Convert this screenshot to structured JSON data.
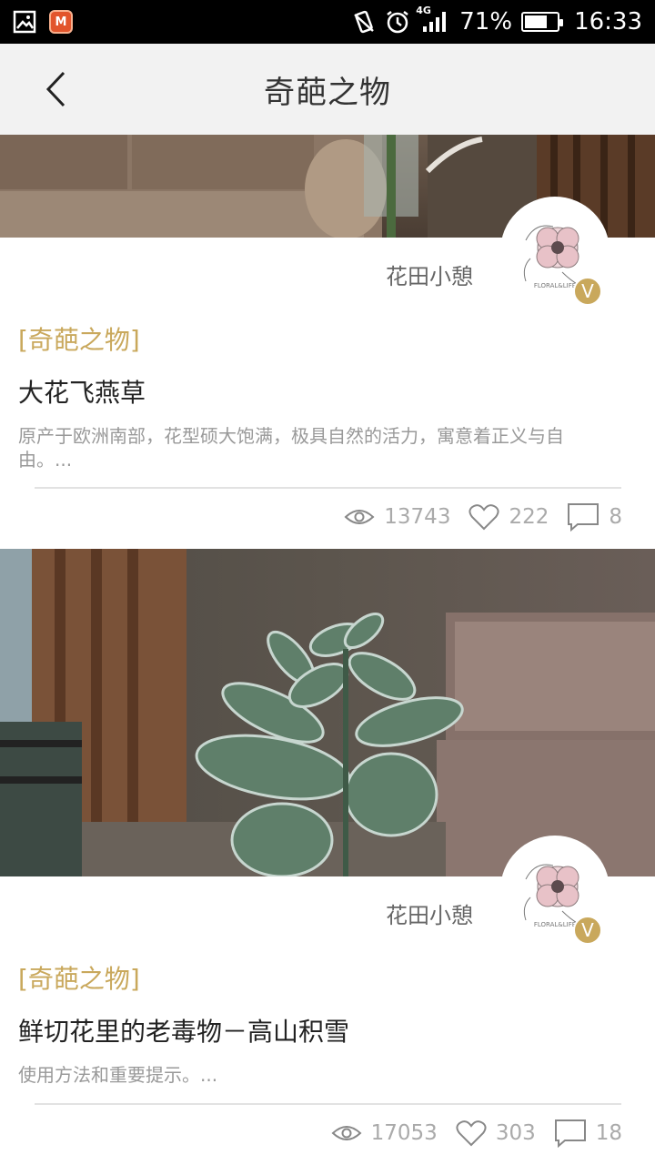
{
  "status_bar": {
    "battery": "71%",
    "time": "16:33",
    "network": "4G",
    "battery_level": 0.71
  },
  "header": {
    "title": "奇葩之物"
  },
  "articles": [
    {
      "author": "花田小憩",
      "badge": "V",
      "avatar_text": "FLORAL&LIFE",
      "tag": "[奇葩之物]",
      "title": "大花飞燕草",
      "description": "原产于欧洲南部，花型硕大饱满，极具自然的活力，寓意着正义与自由。...",
      "views": "13743",
      "likes": "222",
      "comments": "8"
    },
    {
      "author": "花田小憩",
      "badge": "V",
      "avatar_text": "FLORAL&LIFE",
      "tag": "[奇葩之物]",
      "title": "鲜切花里的老毒物－高山积雪",
      "description": "使用方法和重要提示。...",
      "views": "17053",
      "likes": "303",
      "comments": "18"
    }
  ],
  "colors": {
    "accent": "#c9a85c",
    "header_bg": "#f2f2f2",
    "muted": "#aaaaaa"
  }
}
